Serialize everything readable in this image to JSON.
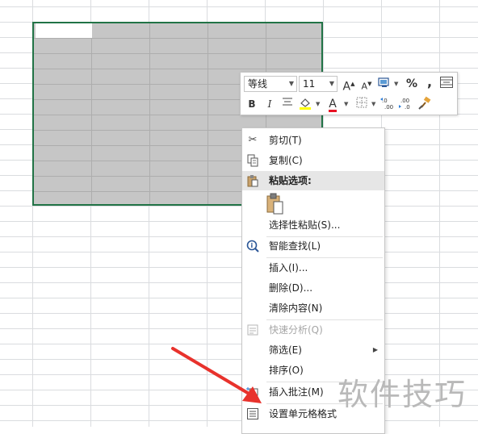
{
  "toolbar": {
    "font_name": "等线",
    "font_size": "11",
    "grow_font": "A",
    "shrink_font": "A",
    "percent": "%",
    "comma": ",",
    "bold": "B",
    "italic": "I",
    "font_color_letter": "A"
  },
  "menu": {
    "cut": "剪切(T)",
    "copy": "复制(C)",
    "paste_options": "粘贴选项:",
    "paste_special": "选择性粘贴(S)...",
    "smart_lookup": "智能查找(L)",
    "insert": "插入(I)...",
    "delete": "删除(D)...",
    "clear_contents": "清除内容(N)",
    "quick_analysis": "快速分析(Q)",
    "filter": "筛选(E)",
    "sort": "排序(O)",
    "insert_comment": "插入批注(M)",
    "format_cells": "设置单元格格式"
  },
  "colors": {
    "selection_border": "#217346",
    "font_color": "#e81123",
    "fill_color": "#ffff00",
    "arrow": "#e8322c"
  },
  "watermark": "软件技巧"
}
